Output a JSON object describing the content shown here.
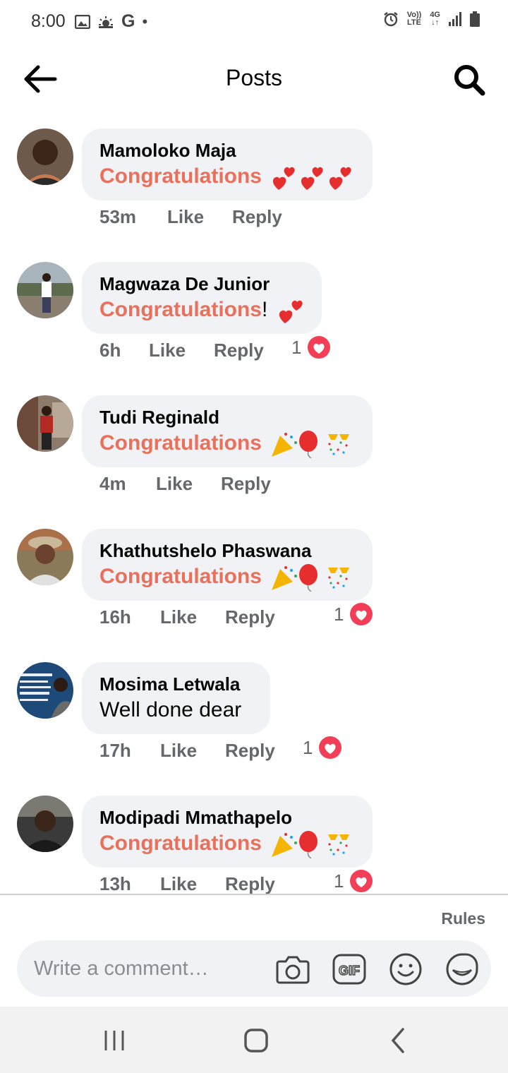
{
  "status_bar": {
    "time": "8:00",
    "left_icons": [
      "image-icon",
      "weather-icon",
      "google-icon",
      "dot"
    ],
    "google_letter": "G",
    "volte_label": "Vo))\nLTE",
    "network_label": "4G",
    "right_icons": [
      "alarm-icon",
      "volte-icon",
      "4g-icon",
      "signal-icon",
      "battery-icon"
    ]
  },
  "header": {
    "title": "Posts",
    "back_icon": "back-arrow-icon",
    "search_icon": "search-icon"
  },
  "colors": {
    "accent_text": "#e9705b",
    "bubble_bg": "#f0f2f5",
    "meta_text": "#65676b",
    "heart_red": "#f33e58"
  },
  "comments": [
    {
      "name": "Mamoloko Maja",
      "text": "Congratulations",
      "suffix": "",
      "emojis": "hearts",
      "time": "53m",
      "like_label": "Like",
      "reply_label": "Reply",
      "reactions": ""
    },
    {
      "name": "Magwaza De Junior",
      "text": "Congratulations",
      "suffix": "!",
      "emojis": "heart-single",
      "time": "6h",
      "like_label": "Like",
      "reply_label": "Reply",
      "reactions": "1"
    },
    {
      "name": "Tudi Reginald",
      "text": "Congratulations",
      "suffix": "",
      "emojis": "party",
      "time": "4m",
      "like_label": "Like",
      "reply_label": "Reply",
      "reactions": ""
    },
    {
      "name": "Khathutshelo Phaswana",
      "text": "Congratulations",
      "suffix": "",
      "emojis": "party",
      "time": "16h",
      "like_label": "Like",
      "reply_label": "Reply",
      "reactions": "1"
    },
    {
      "name": "Mosima Letwala",
      "text": "Well done dear",
      "suffix": "",
      "emojis": "",
      "time": "17h",
      "like_label": "Like",
      "reply_label": "Reply",
      "reactions": "1"
    },
    {
      "name": "Modipadi Mmathapelo",
      "text": "Congratulations",
      "suffix": "",
      "emojis": "party",
      "time": "13h",
      "like_label": "Like",
      "reply_label": "Reply",
      "reactions": "1"
    }
  ],
  "composer": {
    "rules_label": "Rules",
    "placeholder": "Write a comment…",
    "icons": [
      "camera-icon",
      "gif-icon",
      "emoji-icon",
      "sticker-icon"
    ],
    "gif_label": "GIF"
  },
  "nav_bar": {
    "icons": [
      "recent-apps-icon",
      "home-icon",
      "back-nav-icon"
    ]
  }
}
